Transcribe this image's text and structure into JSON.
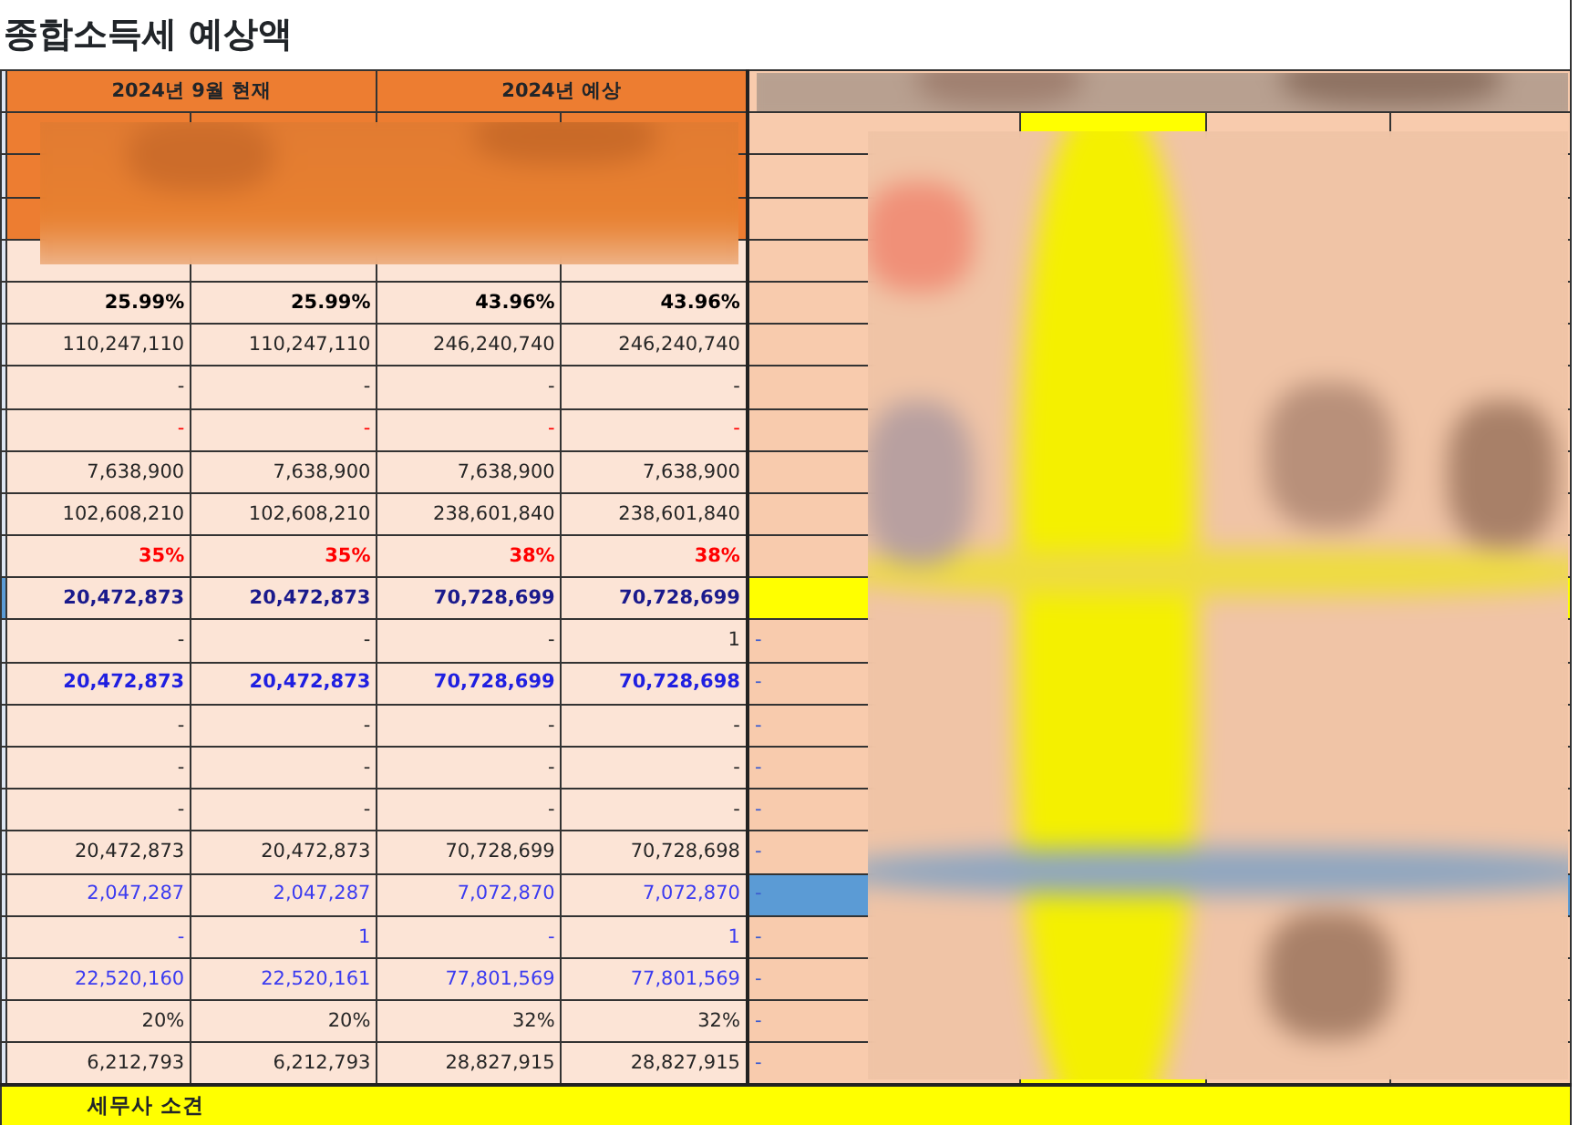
{
  "title": "종합소득세 예상액",
  "header": {
    "groups": [
      {
        "label": "2024년 9월 현재"
      },
      {
        "label": "2024년 예상"
      }
    ]
  },
  "rows": [
    {
      "values": [
        "25.99%",
        "25.99%",
        "43.96%",
        "43.96%"
      ],
      "bold": true,
      "color": "#000000",
      "kind": "plain"
    },
    {
      "values": [
        "110,247,110",
        "110,247,110",
        "246,240,740",
        "246,240,740"
      ],
      "bold": false,
      "color": "#262626",
      "kind": "plain"
    },
    {
      "values": [
        "-",
        "-",
        "-",
        "-"
      ],
      "bold": false,
      "color": "#262626",
      "kind": "plain"
    },
    {
      "values": [
        "-",
        "-",
        "-",
        "-"
      ],
      "bold": false,
      "color": "#ff0000",
      "kind": "plain"
    },
    {
      "values": [
        "7,638,900",
        "7,638,900",
        "7,638,900",
        "7,638,900"
      ],
      "bold": false,
      "color": "#262626",
      "kind": "plain"
    },
    {
      "values": [
        "102,608,210",
        "102,608,210",
        "238,601,840",
        "238,601,840"
      ],
      "bold": false,
      "color": "#262626",
      "kind": "plain"
    },
    {
      "values": [
        "35%",
        "35%",
        "38%",
        "38%"
      ],
      "bold": true,
      "color": "#ff0000",
      "kind": "plain"
    },
    {
      "values": [
        "20,472,873",
        "20,472,873",
        "70,728,699",
        "70,728,699"
      ],
      "bold": true,
      "color": "#1a1a8c",
      "kind": "flagged"
    },
    {
      "values": [
        "-",
        "-",
        "-",
        "1"
      ],
      "bold": false,
      "color": "#262626",
      "kind": "plain",
      "note": "-"
    },
    {
      "values": [
        "20,472,873",
        "20,472,873",
        "70,728,699",
        "70,728,698"
      ],
      "bold": true,
      "color": "#1f1fe0",
      "kind": "plain",
      "note": "-"
    },
    {
      "values": [
        "-",
        "-",
        "-",
        "-"
      ],
      "bold": false,
      "color": "#262626",
      "kind": "plain",
      "note": "-"
    },
    {
      "values": [
        "-",
        "-",
        "-",
        "-"
      ],
      "bold": false,
      "color": "#262626",
      "kind": "plain",
      "note": "-"
    },
    {
      "values": [
        "-",
        "-",
        "-",
        "-"
      ],
      "bold": false,
      "color": "#262626",
      "kind": "plain",
      "note": "-"
    },
    {
      "values": [
        "20,472,873",
        "20,472,873",
        "70,728,699",
        "70,728,698"
      ],
      "bold": false,
      "color": "#262626",
      "kind": "plain",
      "note": "-"
    },
    {
      "values": [
        "2,047,287",
        "2,047,287",
        "7,072,870",
        "7,072,870"
      ],
      "bold": false,
      "color": "#3b3bf0",
      "kind": "accent",
      "note": "-"
    },
    {
      "values": [
        "-",
        "1",
        "-",
        "1"
      ],
      "bold": false,
      "color": "#3b3bf0",
      "kind": "plain",
      "note": "-"
    },
    {
      "values": [
        "22,520,160",
        "22,520,161",
        "77,801,569",
        "77,801,569"
      ],
      "bold": false,
      "color": "#3b3bf0",
      "kind": "plain",
      "note": "-"
    },
    {
      "values": [
        "20%",
        "20%",
        "32%",
        "32%"
      ],
      "bold": false,
      "color": "#262626",
      "kind": "plain",
      "note": "-"
    },
    {
      "values": [
        "6,212,793",
        "6,212,793",
        "28,827,915",
        "28,827,915"
      ],
      "bold": false,
      "color": "#262626",
      "kind": "plain",
      "note": "-"
    }
  ],
  "footer": {
    "label": "세무사 소견"
  }
}
